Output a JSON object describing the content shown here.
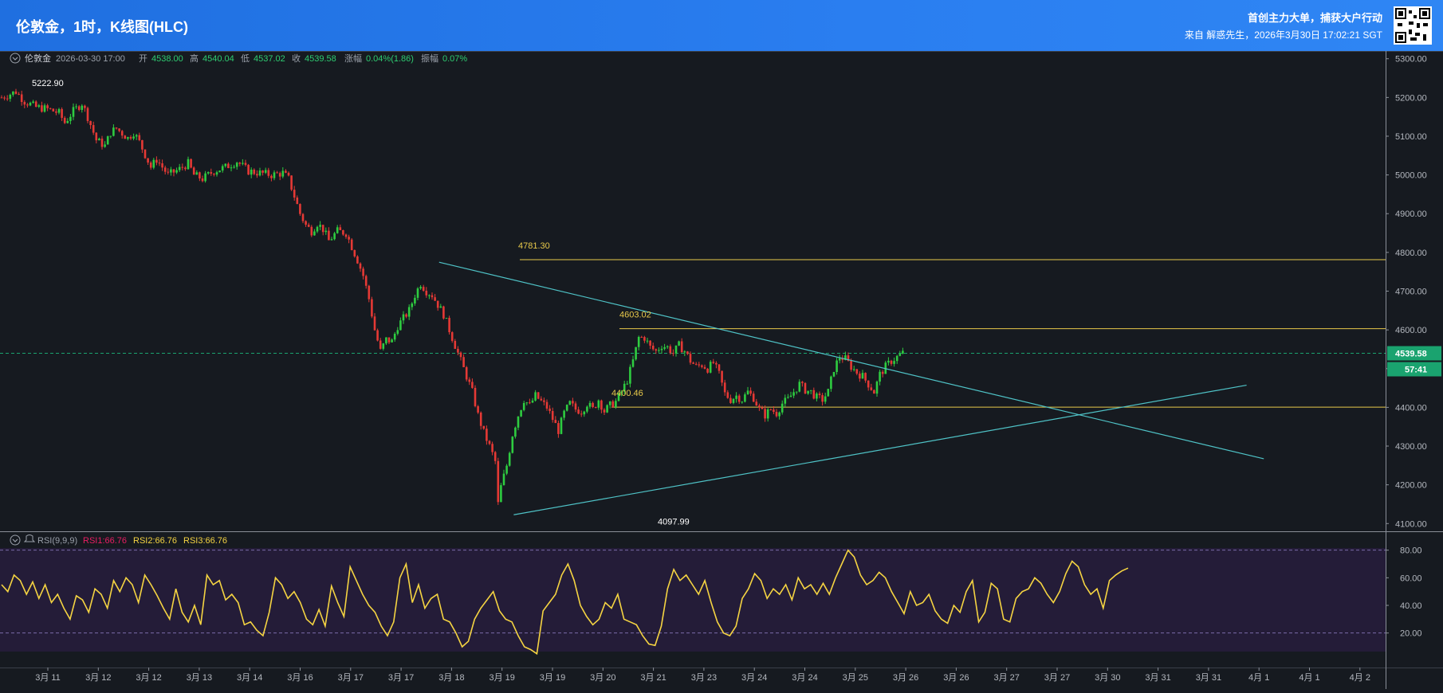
{
  "header": {
    "title": "伦敦金，1时，K线图(HLC)",
    "slogan": "首创主力大单，捕获大户行动",
    "source": "来自 解惑先生，2026年3月30日 17:02:21 SGT"
  },
  "info_bar": {
    "symbol": "伦敦金",
    "datetime": "2026-03-30 17:00",
    "open_label": "开",
    "open": "4538.00",
    "high_label": "高",
    "high": "4540.04",
    "low_label": "低",
    "low": "4537.02",
    "close_label": "收",
    "close": "4539.58",
    "change_label": "涨幅",
    "change": "0.04%(1.86)",
    "amplitude_label": "振幅",
    "amplitude": "0.07%"
  },
  "rsi_bar": {
    "label": "RSI(9,9,9)",
    "rsi1": "RSI1:66.76",
    "rsi2": "RSI2:66.76",
    "rsi3": "RSI3:66.76"
  },
  "colors": {
    "up": "#26a69a",
    "up_bright": "#2ecc40",
    "down": "#e53935",
    "level": "#e8c94a",
    "trend": "#4fc3c7",
    "rsi": "#f5d442",
    "price_tag": "#1aa36f"
  },
  "chart_data": [
    {
      "type": "candlestick",
      "ylim": [
        4080,
        5320
      ],
      "y_ticks": [
        "5300.00",
        "5200.00",
        "5100.00",
        "5000.00",
        "4900.00",
        "4800.00",
        "4700.00",
        "4600.00",
        "4500.00",
        "4400.00",
        "4300.00",
        "4200.00",
        "4100.00"
      ],
      "x_ticks": [
        "3月 11",
        "3月 12",
        "3月 12",
        "3月 13",
        "3月 14",
        "3月 16",
        "3月 17",
        "3月 17",
        "3月 18",
        "3月 19",
        "3月 19",
        "3月 20",
        "3月 21",
        "3月 23",
        "3月 24",
        "3月 24",
        "3月 25",
        "3月 26",
        "3月 26",
        "3月 27",
        "3月 27",
        "3月 30",
        "3月 31",
        "3月 31",
        "4月 1",
        "4月 1",
        "4月 2"
      ],
      "current_price": "4539.58",
      "countdown": "57:41",
      "annotations": [
        {
          "text": "5222.90",
          "value": 5222.9
        },
        {
          "text": "4781.30",
          "value": 4781.3
        },
        {
          "text": "4603.02",
          "value": 4603.02
        },
        {
          "text": "4400.46",
          "value": 4400.46
        },
        {
          "text": "4097.99",
          "value": 4097.99
        }
      ],
      "horizontal_levels": [
        4781.3,
        4603.02,
        4400.46
      ],
      "close_path": [
        [
          0,
          5200
        ],
        [
          5,
          5215
        ],
        [
          8,
          5190
        ],
        [
          12,
          5175
        ],
        [
          16,
          5170
        ],
        [
          20,
          5160
        ],
        [
          22,
          5135
        ],
        [
          25,
          5165
        ],
        [
          28,
          5185
        ],
        [
          30,
          5150
        ],
        [
          33,
          5090
        ],
        [
          36,
          5075
        ],
        [
          38,
          5110
        ],
        [
          40,
          5120
        ],
        [
          44,
          5095
        ],
        [
          46,
          5110
        ],
        [
          48,
          5085
        ],
        [
          52,
          5020
        ],
        [
          54,
          5040
        ],
        [
          58,
          5000
        ],
        [
          62,
          5015
        ],
        [
          65,
          5030
        ],
        [
          67,
          5000
        ],
        [
          70,
          4990
        ],
        [
          74,
          5010
        ],
        [
          78,
          5020
        ],
        [
          82,
          5035
        ],
        [
          86,
          5010
        ],
        [
          90,
          5005
        ],
        [
          94,
          5000
        ],
        [
          98,
          5005
        ],
        [
          100,
          4990
        ],
        [
          104,
          4900
        ],
        [
          106,
          4870
        ],
        [
          108,
          4855
        ],
        [
          110,
          4875
        ],
        [
          112,
          4860
        ],
        [
          114,
          4830
        ],
        [
          117,
          4855
        ],
        [
          120,
          4850
        ],
        [
          124,
          4780
        ],
        [
          126,
          4740
        ],
        [
          128,
          4680
        ],
        [
          130,
          4600
        ],
        [
          132,
          4545
        ],
        [
          134,
          4575
        ],
        [
          136,
          4570
        ],
        [
          138,
          4610
        ],
        [
          140,
          4630
        ],
        [
          142,
          4650
        ],
        [
          144,
          4690
        ],
        [
          146,
          4720
        ],
        [
          148,
          4700
        ],
        [
          150,
          4690
        ],
        [
          152,
          4665
        ],
        [
          154,
          4640
        ],
        [
          156,
          4600
        ],
        [
          158,
          4560
        ],
        [
          160,
          4520
        ],
        [
          162,
          4480
        ],
        [
          164,
          4440
        ],
        [
          166,
          4380
        ],
        [
          168,
          4335
        ],
        [
          170,
          4300
        ],
        [
          172,
          4260
        ],
        [
          173,
          4150
        ],
        [
          174,
          4195
        ],
        [
          176,
          4250
        ],
        [
          178,
          4330
        ],
        [
          180,
          4380
        ],
        [
          182,
          4420
        ],
        [
          184,
          4405
        ],
        [
          186,
          4430
        ],
        [
          188,
          4415
        ],
        [
          190,
          4400
        ],
        [
          192,
          4370
        ],
        [
          194,
          4340
        ],
        [
          196,
          4385
        ],
        [
          198,
          4410
        ],
        [
          200,
          4395
        ],
        [
          202,
          4390
        ],
        [
          204,
          4410
        ],
        [
          206,
          4395
        ],
        [
          208,
          4420
        ],
        [
          210,
          4390
        ],
        [
          212,
          4405
        ],
        [
          214,
          4415
        ],
        [
          216,
          4440
        ],
        [
          218,
          4470
        ],
        [
          220,
          4520
        ],
        [
          222,
          4580
        ],
        [
          224,
          4580
        ],
        [
          226,
          4555
        ],
        [
          228,
          4545
        ],
        [
          230,
          4560
        ],
        [
          232,
          4555
        ],
        [
          234,
          4540
        ],
        [
          236,
          4560
        ],
        [
          238,
          4545
        ],
        [
          240,
          4520
        ],
        [
          242,
          4505
        ],
        [
          244,
          4510
        ],
        [
          246,
          4500
        ],
        [
          248,
          4515
        ],
        [
          250,
          4485
        ],
        [
          252,
          4435
        ],
        [
          254,
          4420
        ],
        [
          256,
          4430
        ],
        [
          258,
          4420
        ],
        [
          260,
          4440
        ],
        [
          262,
          4425
        ],
        [
          264,
          4395
        ],
        [
          266,
          4380
        ],
        [
          268,
          4395
        ],
        [
          270,
          4385
        ],
        [
          272,
          4410
        ],
        [
          274,
          4420
        ],
        [
          276,
          4440
        ],
        [
          278,
          4460
        ],
        [
          280,
          4445
        ],
        [
          282,
          4440
        ],
        [
          284,
          4425
        ],
        [
          286,
          4420
        ],
        [
          288,
          4440
        ],
        [
          290,
          4500
        ],
        [
          292,
          4530
        ],
        [
          294,
          4525
        ],
        [
          296,
          4505
        ],
        [
          298,
          4490
        ],
        [
          300,
          4480
        ],
        [
          302,
          4460
        ],
        [
          304,
          4440
        ],
        [
          306,
          4485
        ],
        [
          308,
          4505
        ],
        [
          310,
          4520
        ],
        [
          312,
          4530
        ],
        [
          314,
          4540
        ]
      ],
      "trendlines": [
        {
          "from": [
            148,
            4750
          ],
          "to": [
            312,
            4370
          ]
        },
        {
          "from": [
            174,
            4097.99
          ],
          "to": [
            306,
            4560
          ]
        }
      ],
      "total_bars": 350
    },
    {
      "type": "line",
      "name": "RSI",
      "ylim": [
        10,
        85
      ],
      "y_ticks": [
        "80.00",
        "60.00",
        "40.00",
        "20.00"
      ],
      "reference_lines": [
        80,
        20
      ],
      "values": [
        55,
        50,
        62,
        58,
        48,
        57,
        45,
        55,
        42,
        48,
        38,
        30,
        47,
        44,
        35,
        52,
        48,
        38,
        58,
        50,
        60,
        55,
        42,
        62,
        55,
        47,
        38,
        30,
        52,
        35,
        28,
        40,
        26,
        62,
        55,
        58,
        44,
        48,
        42,
        26,
        28,
        22,
        18,
        35,
        60,
        55,
        45,
        50,
        42,
        30,
        26,
        37,
        25,
        54,
        42,
        32,
        68,
        58,
        48,
        40,
        35,
        25,
        18,
        28,
        60,
        70,
        42,
        55,
        38,
        45,
        48,
        30,
        28,
        20,
        10,
        14,
        30,
        38,
        44,
        50,
        36,
        30,
        28,
        18,
        10,
        8,
        5,
        36,
        42,
        48,
        62,
        70,
        58,
        40,
        32,
        26,
        30,
        42,
        38,
        48,
        30,
        28,
        26,
        18,
        12,
        11,
        25,
        52,
        66,
        58,
        62,
        55,
        48,
        58,
        42,
        28,
        20,
        18,
        25,
        45,
        52,
        63,
        58,
        45,
        52,
        48,
        55,
        44,
        60,
        52,
        55,
        48,
        56,
        48,
        60,
        70,
        80,
        75,
        62,
        55,
        58,
        64,
        60,
        50,
        42,
        34,
        50,
        40,
        42,
        48,
        36,
        30,
        27,
        40,
        35,
        50,
        58,
        28,
        35,
        56,
        52,
        30,
        28,
        45,
        50,
        52,
        60,
        56,
        48,
        42,
        50,
        63,
        72,
        68,
        55,
        48,
        52,
        38,
        58,
        62,
        65,
        67
      ]
    }
  ]
}
